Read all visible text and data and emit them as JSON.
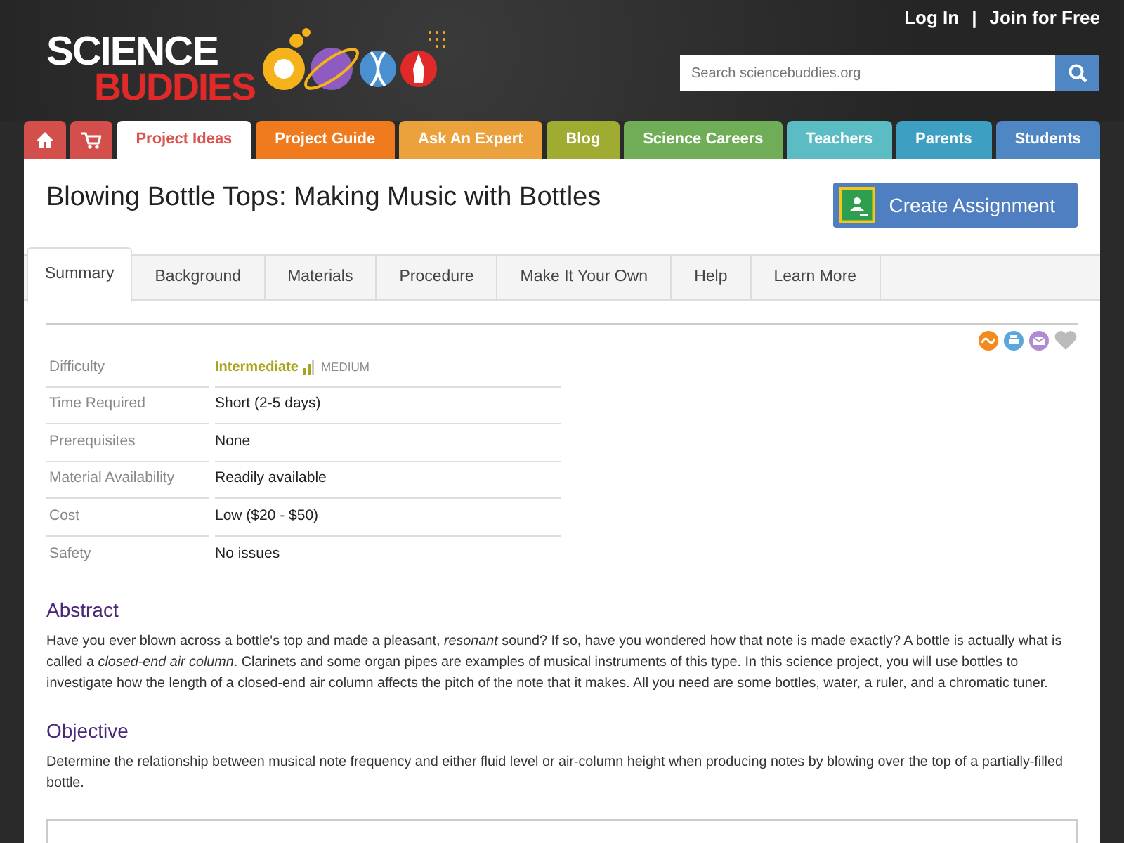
{
  "header": {
    "logo": {
      "line1": "SCIENCE",
      "line2": "BUDDIES"
    },
    "account_links": [
      "Log In",
      "Join for Free"
    ],
    "separator": "|",
    "search": {
      "placeholder": "Search sciencebuddies.org"
    }
  },
  "nav": [
    {
      "label": "Project Ideas",
      "color": "#d9534f",
      "selected": true
    },
    {
      "label": "Project Guide",
      "color": "#f07a1e",
      "selected": false
    },
    {
      "label": "Ask An Expert",
      "color": "#eba13c",
      "selected": false
    },
    {
      "label": "Blog",
      "color": "#a0ab32",
      "selected": false
    },
    {
      "label": "Science Careers",
      "color": "#6fae56",
      "selected": false
    },
    {
      "label": "Teachers",
      "color": "#5bbcc4",
      "selected": false
    },
    {
      "label": "Parents",
      "color": "#3d9fc1",
      "selected": false
    },
    {
      "label": "Students",
      "color": "#4f86c4",
      "selected": false
    }
  ],
  "page_title": "Blowing Bottle Tops: Making Music with Bottles",
  "create_button": "Create Assignment",
  "tabs": [
    {
      "label": "Summary",
      "selected": true
    },
    {
      "label": "Background",
      "selected": false
    },
    {
      "label": "Materials",
      "selected": false
    },
    {
      "label": "Procedure",
      "selected": false
    },
    {
      "label": "Make It Your Own",
      "selected": false
    },
    {
      "label": "Help",
      "selected": false
    },
    {
      "label": "Learn More",
      "selected": false
    }
  ],
  "summary": [
    {
      "label": "Difficulty",
      "kind": "difficulty",
      "value": "Intermediate",
      "note": "MEDIUM"
    },
    {
      "label": "Time Required",
      "kind": "text",
      "value": "Short (2-5 days)"
    },
    {
      "label": "Prerequisites",
      "kind": "text",
      "value": "None"
    },
    {
      "label": "Material Availability",
      "kind": "text",
      "value": "Readily available"
    },
    {
      "label": "Cost",
      "kind": "text",
      "value": "Low ($20 - $50)"
    },
    {
      "label": "Safety",
      "kind": "text",
      "value": "No issues"
    }
  ],
  "sections": [
    {
      "heading": "Abstract",
      "text": "Have you ever blown across a bottle's top and made a pleasant, *resonant* sound? If so, have you wondered how that note is made exactly? A bottle is actually what is called a *closed-end air column*. Clarinets and some organ pipes are examples of musical instruments of this type. In this science project, you will use bottles to investigate how the length of a closed-end air column affects the pitch of the note that it makes. All you need are some bottles, water, a ruler, and a chromatic tuner."
    },
    {
      "heading": "Objective",
      "text": "Determine the relationship between musical note frequency and either fluid level or air-column height when producing notes by blowing over the top of a partially-filled bottle."
    }
  ]
}
